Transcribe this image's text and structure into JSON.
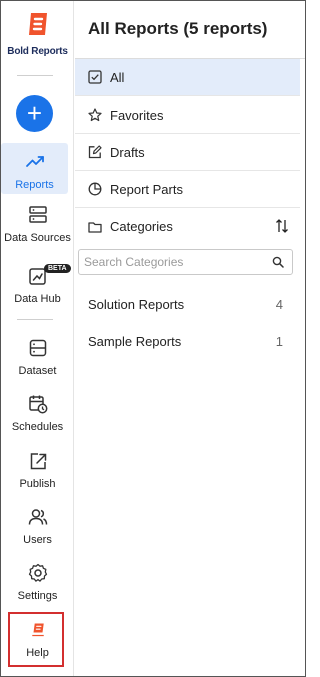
{
  "brand": {
    "name": "Bold Reports"
  },
  "add_button": {
    "label": "+"
  },
  "rail": {
    "items": [
      {
        "label": "Reports",
        "icon": "trend-icon",
        "active": true
      },
      {
        "label": "Data Sources",
        "icon": "server-icon"
      },
      {
        "label": "Data Hub",
        "icon": "data-hub-icon",
        "badge": "BETA"
      },
      {
        "label": "Dataset",
        "icon": "dataset-icon"
      },
      {
        "label": "Schedules",
        "icon": "calendar-clock-icon"
      },
      {
        "label": "Publish",
        "icon": "publish-icon"
      },
      {
        "label": "Users",
        "icon": "users-icon"
      },
      {
        "label": "Settings",
        "icon": "gear-icon"
      },
      {
        "label": "Help",
        "icon": "help-logo-icon"
      }
    ]
  },
  "header": {
    "title": "All Reports (5 reports)"
  },
  "menu": {
    "items": [
      {
        "label": "All",
        "icon": "checkbox-icon",
        "selected": true
      },
      {
        "label": "Favorites",
        "icon": "star-icon"
      },
      {
        "label": "Drafts",
        "icon": "edit-icon"
      },
      {
        "label": "Report Parts",
        "icon": "pie-icon"
      },
      {
        "label": "Categories",
        "icon": "folder-icon"
      }
    ]
  },
  "search": {
    "placeholder": "Search Categories",
    "value": ""
  },
  "categories": [
    {
      "name": "Solution Reports",
      "count": "4"
    },
    {
      "name": "Sample Reports",
      "count": "1"
    }
  ],
  "colors": {
    "accent": "#1a73e8",
    "active_bg": "#e3ecfa",
    "brand_orange": "#f0542d",
    "highlight_red": "#d32f2f"
  }
}
